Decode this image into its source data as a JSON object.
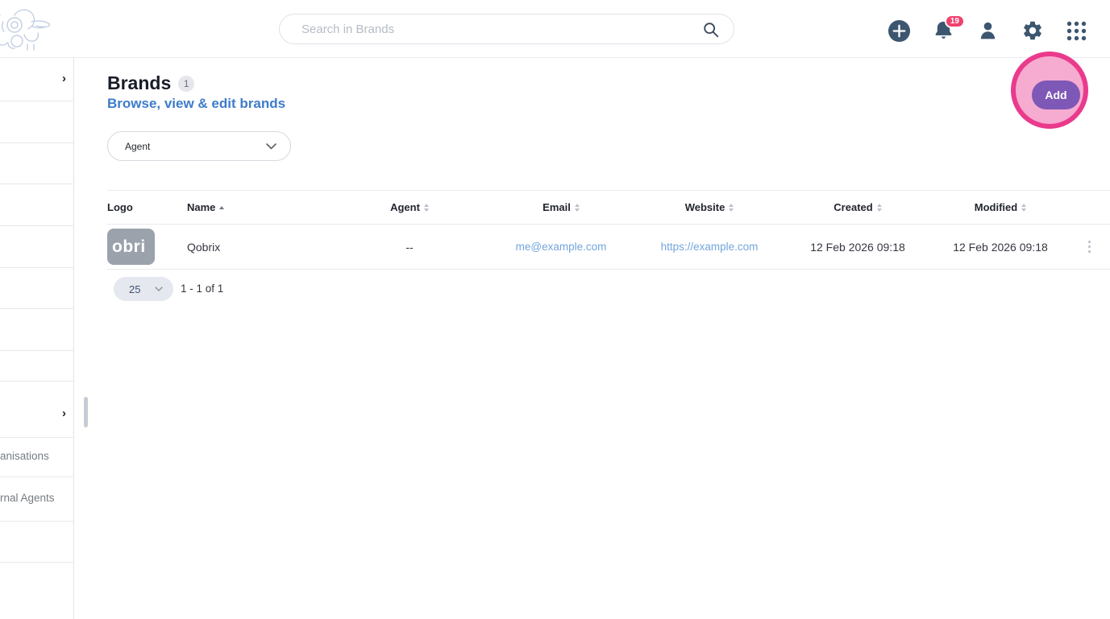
{
  "topbar": {
    "search": {
      "placeholder": "Search in Brands"
    },
    "notifications": {
      "count": "19"
    }
  },
  "sidebar": {
    "collapse_chevron": "›",
    "items": [
      {
        "label": "anisations"
      },
      {
        "label": "rnal Agents"
      }
    ]
  },
  "header": {
    "title": "Brands",
    "count": "1",
    "subtitle": "Browse, view & edit brands"
  },
  "toolbar": {
    "add_label": "Add"
  },
  "filters": {
    "agent": {
      "label": "Agent"
    }
  },
  "table": {
    "columns": [
      {
        "label": "Logo"
      },
      {
        "label": "Name",
        "sorted": "asc"
      },
      {
        "label": "Agent"
      },
      {
        "label": "Email"
      },
      {
        "label": "Website"
      },
      {
        "label": "Created"
      },
      {
        "label": "Modified"
      }
    ],
    "rows": [
      {
        "logo_text": "obri",
        "name": "Qobrix",
        "agent": "--",
        "email": "me@example.com",
        "website": "https://example.com",
        "created": "12 Feb 2026 09:18",
        "modified": "12 Feb 2026 09:18"
      }
    ]
  },
  "pagination": {
    "page_size": "25",
    "range": "1 - 1 of 1"
  },
  "colors": {
    "topbar_icon": "#3d566f",
    "notification_badge": "#f0416c",
    "subtitle_blue": "#3d7cc9",
    "link_blue": "#73a6dc",
    "add_button_purple": "#7e58b6",
    "highlight_ring_pink": "#ea3a8c",
    "highlight_fill_pink": "#f6abd0",
    "logo_tile_gray": "#9ba2ac"
  }
}
